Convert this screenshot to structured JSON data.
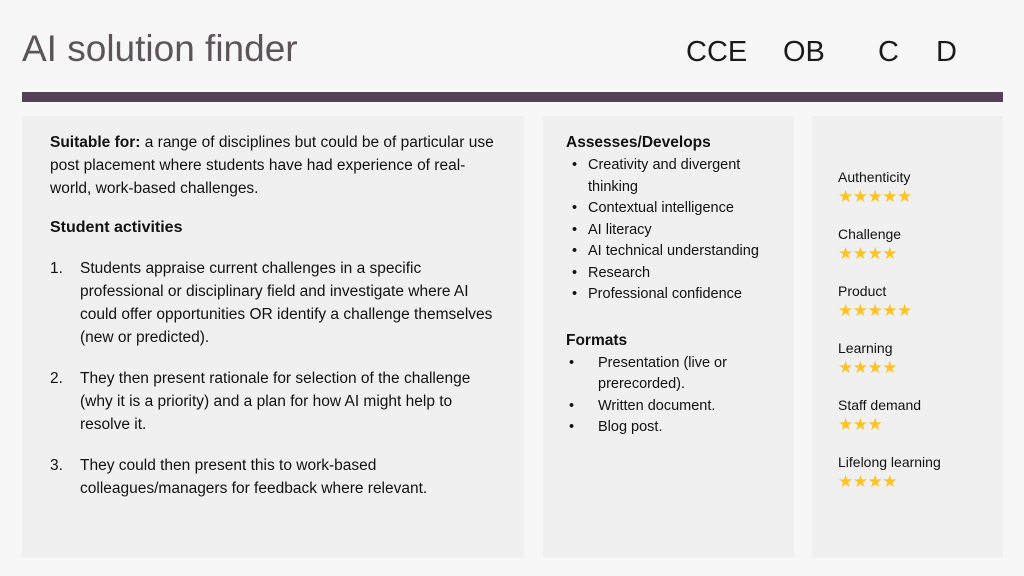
{
  "header": {
    "title": "AI solution finder",
    "tags": [
      "CCE",
      "OB",
      "C",
      "D"
    ],
    "rule_color": "#554158",
    "title_color": "#5d545a"
  },
  "left_panel": {
    "suitable_label": "Suitable for:",
    "suitable_text": " a range of disciplines but could be of particular use post placement where students have had experience of real-world,  work-based challenges.",
    "activities_heading": "Student activities",
    "activities": [
      {
        "marker": "1.",
        "text": "Students appraise current challenges in a specific professional or disciplinary field and investigate where AI could offer opportunities OR identify a challenge themselves (new or predicted)."
      },
      {
        "marker": "2.",
        "text": "They then present rationale for selection of the challenge (why it is a priority) and a plan for how AI might help to resolve it."
      },
      {
        "marker": "3.",
        "text": "They could then present this to work-based colleagues/managers for feedback where relevant."
      }
    ]
  },
  "middle_panel": {
    "assesses_heading": "Assesses/Develops",
    "assesses_items": [
      "Creativity and divergent thinking",
      "Contextual intelligence",
      "AI literacy",
      "AI technical understanding",
      "Research",
      "Professional confidence"
    ],
    "formats_heading": "Formats",
    "formats_items": [
      "Presentation (live or prerecorded).",
      "Written document.",
      "Blog post."
    ],
    "bullet_glyph": "•"
  },
  "right_panel": {
    "star_color": "#fdc323",
    "star_glyph": "★",
    "max_stars": 5,
    "ratings": [
      {
        "label": "Authenticity",
        "stars": 5
      },
      {
        "label": "Challenge",
        "stars": 4
      },
      {
        "label": "Product",
        "stars": 5
      },
      {
        "label": "Learning",
        "stars": 4
      },
      {
        "label": "Staff demand",
        "stars": 3
      },
      {
        "label": "Lifelong learning",
        "stars": 4
      }
    ]
  }
}
